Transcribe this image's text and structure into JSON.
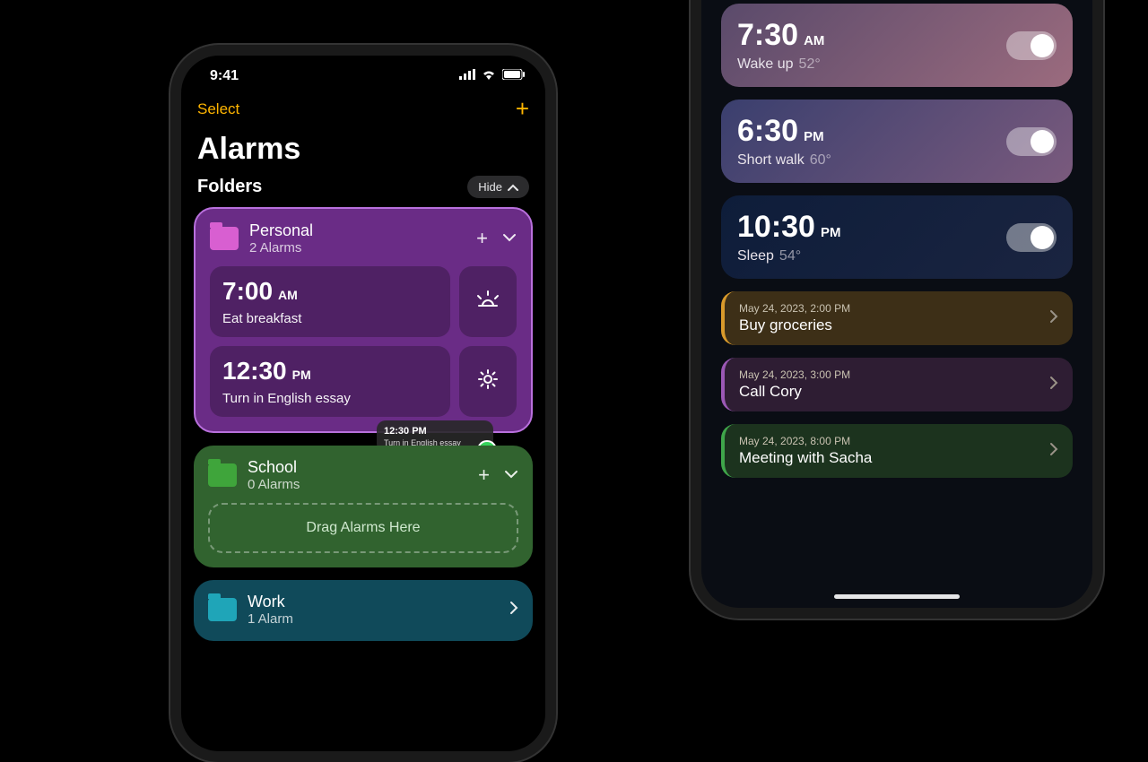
{
  "left": {
    "status_time": "9:41",
    "select_label": "Select",
    "title": "Alarms",
    "folders_label": "Folders",
    "hide_label": "Hide",
    "folders": [
      {
        "name": "Personal",
        "count": "2 Alarms",
        "alarms": [
          {
            "time": "7:00",
            "ampm": "AM",
            "label": "Eat breakfast",
            "icon": "sunrise"
          },
          {
            "time": "12:30",
            "ampm": "PM",
            "label": "Turn in English essay",
            "icon": "sun"
          }
        ]
      },
      {
        "name": "School",
        "count": "0 Alarms",
        "drop_label": "Drag Alarms Here"
      },
      {
        "name": "Work",
        "count": "1 Alarm"
      }
    ],
    "drag_preview": {
      "time": "12:30 PM",
      "label": "Turn in English essay"
    }
  },
  "right": {
    "alarms": [
      {
        "time": "7:30",
        "ampm": "AM",
        "label": "Wake up",
        "temp": "52°",
        "theme": "sunrise"
      },
      {
        "time": "6:30",
        "ampm": "PM",
        "label": "Short walk",
        "temp": "60°",
        "theme": "sunset"
      },
      {
        "time": "10:30",
        "ampm": "PM",
        "label": "Sleep",
        "temp": "54°",
        "theme": "night"
      }
    ],
    "reminders": [
      {
        "date": "May 24, 2023, 2:00 PM",
        "title": "Buy groceries",
        "color": "orange"
      },
      {
        "date": "May 24, 2023, 3:00 PM",
        "title": "Call Cory",
        "color": "purple"
      },
      {
        "date": "May 24, 2023, 8:00 PM",
        "title": "Meeting with Sacha",
        "color": "green"
      }
    ]
  }
}
